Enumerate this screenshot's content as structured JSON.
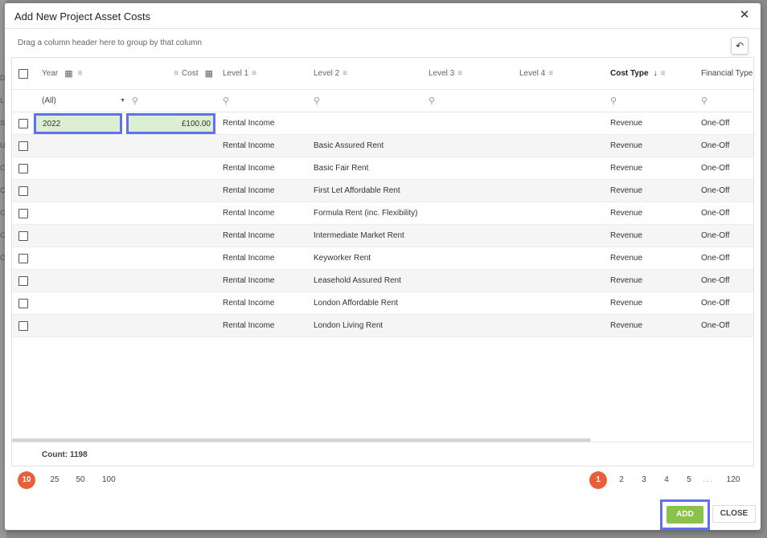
{
  "dialog": {
    "title": "Add New Project Asset Costs",
    "group_panel_text": "Drag a column header here to group by that column"
  },
  "columns": [
    {
      "key": "year",
      "label": "Year"
    },
    {
      "key": "cost",
      "label": "Cost"
    },
    {
      "key": "level1",
      "label": "Level 1"
    },
    {
      "key": "level2",
      "label": "Level 2"
    },
    {
      "key": "level3",
      "label": "Level 3"
    },
    {
      "key": "level4",
      "label": "Level 4"
    },
    {
      "key": "cost_type",
      "label": "Cost Type",
      "sorted": "descending"
    },
    {
      "key": "financial_type",
      "label": "Financial Type"
    }
  ],
  "filter": {
    "year_value": "(All)"
  },
  "edit_row": {
    "year": "2022",
    "cost": "£100.00"
  },
  "rows": [
    {
      "level1": "Rental Income",
      "level2": "",
      "cost_type": "Revenue",
      "financial_type": "One-Off"
    },
    {
      "level1": "Rental Income",
      "level2": "Basic Assured Rent",
      "cost_type": "Revenue",
      "financial_type": "One-Off"
    },
    {
      "level1": "Rental Income",
      "level2": "Basic Fair Rent",
      "cost_type": "Revenue",
      "financial_type": "One-Off"
    },
    {
      "level1": "Rental Income",
      "level2": "First Let Affordable Rent",
      "cost_type": "Revenue",
      "financial_type": "One-Off"
    },
    {
      "level1": "Rental Income",
      "level2": "Formula Rent (inc. Flexibility)",
      "cost_type": "Revenue",
      "financial_type": "One-Off"
    },
    {
      "level1": "Rental Income",
      "level2": "Intermediate Market Rent",
      "cost_type": "Revenue",
      "financial_type": "One-Off"
    },
    {
      "level1": "Rental Income",
      "level2": "Keyworker Rent",
      "cost_type": "Revenue",
      "financial_type": "One-Off"
    },
    {
      "level1": "Rental Income",
      "level2": "Leasehold Assured Rent",
      "cost_type": "Revenue",
      "financial_type": "One-Off"
    },
    {
      "level1": "Rental Income",
      "level2": "London Affordable Rent",
      "cost_type": "Revenue",
      "financial_type": "One-Off"
    },
    {
      "level1": "Rental Income",
      "level2": "London Living Rent",
      "cost_type": "Revenue",
      "financial_type": "One-Off"
    }
  ],
  "footer": {
    "count": "Count: 1198"
  },
  "pager": {
    "page_sizes": [
      "10",
      "25",
      "50",
      "100"
    ],
    "active_page_size": "10",
    "pages": [
      "1",
      "2",
      "3",
      "4",
      "5",
      "...",
      "120"
    ],
    "active_page": "1"
  },
  "buttons": {
    "add": "ADD",
    "close": "CLOSE"
  },
  "background_letters": [
    "D",
    "L",
    "S",
    "U",
    "C",
    "C",
    "C",
    "C",
    "C"
  ],
  "colors": {
    "accent_orange": "#e8603a",
    "add_green": "#8bc34a",
    "highlight_blue": "#6070f0",
    "edit_cell_bg": "#dcefd2"
  }
}
